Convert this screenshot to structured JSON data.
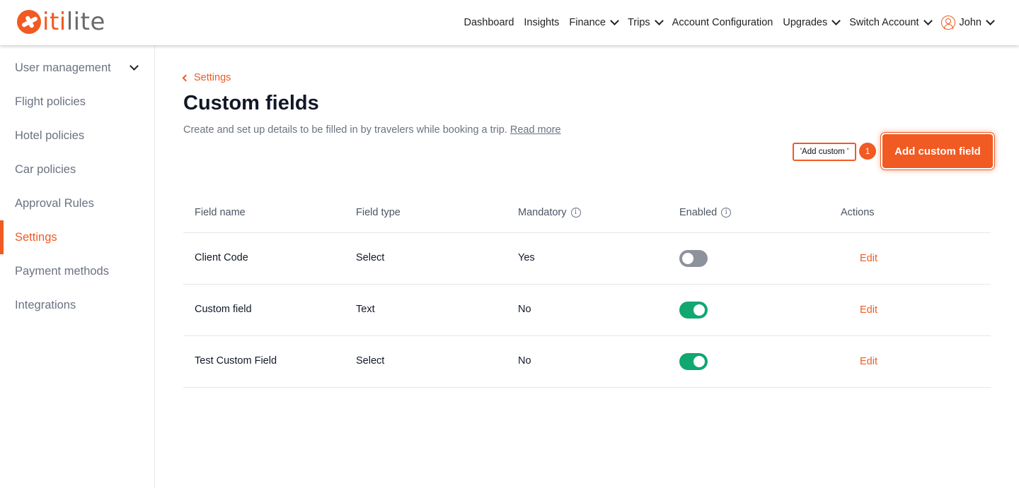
{
  "brand": {
    "logo_prefix": "iti",
    "logo_suffix": "lite",
    "accent_color": "#f15a22"
  },
  "nav": {
    "items": [
      {
        "label": "Dashboard",
        "has_dropdown": false
      },
      {
        "label": "Insights",
        "has_dropdown": false
      },
      {
        "label": "Finance",
        "has_dropdown": true
      },
      {
        "label": "Trips",
        "has_dropdown": true
      },
      {
        "label": "Account Configuration",
        "has_dropdown": false
      },
      {
        "label": "Upgrades",
        "has_dropdown": true
      },
      {
        "label": "Switch Account",
        "has_dropdown": true
      }
    ],
    "user": {
      "name": "John",
      "icon": "user-circle-icon"
    }
  },
  "sidebar": {
    "items": [
      {
        "label": "User management",
        "expandable": true,
        "active": false
      },
      {
        "label": "Flight policies",
        "active": false
      },
      {
        "label": "Hotel policies",
        "active": false
      },
      {
        "label": "Car policies",
        "active": false
      },
      {
        "label": "Approval Rules",
        "active": false
      },
      {
        "label": "Settings",
        "active": true
      },
      {
        "label": "Payment methods",
        "active": false
      },
      {
        "label": "Integrations",
        "active": false
      }
    ]
  },
  "main": {
    "back_label": "Settings",
    "title": "Custom fields",
    "subtitle": "Create and set up details to be filled in by travelers while booking a trip.",
    "read_more": "Read more",
    "add_button": "Add custom field",
    "annotation": {
      "tooltip": "'Add custom '",
      "step": "1"
    }
  },
  "table": {
    "headers": {
      "field_name": "Field name",
      "field_type": "Field type",
      "mandatory": "Mandatory",
      "enabled": "Enabled",
      "actions": "Actions"
    },
    "info_icon": "i",
    "rows": [
      {
        "field_name": "Client Code",
        "field_type": "Select",
        "mandatory": "Yes",
        "enabled": false,
        "action": "Edit"
      },
      {
        "field_name": "Custom field",
        "field_type": "Text",
        "mandatory": "No",
        "enabled": true,
        "action": "Edit"
      },
      {
        "field_name": "Test Custom Field",
        "field_type": "Select",
        "mandatory": "No",
        "enabled": true,
        "action": "Edit"
      }
    ]
  },
  "colors": {
    "toggle_on": "#10a870",
    "toggle_off": "#8e929c"
  }
}
